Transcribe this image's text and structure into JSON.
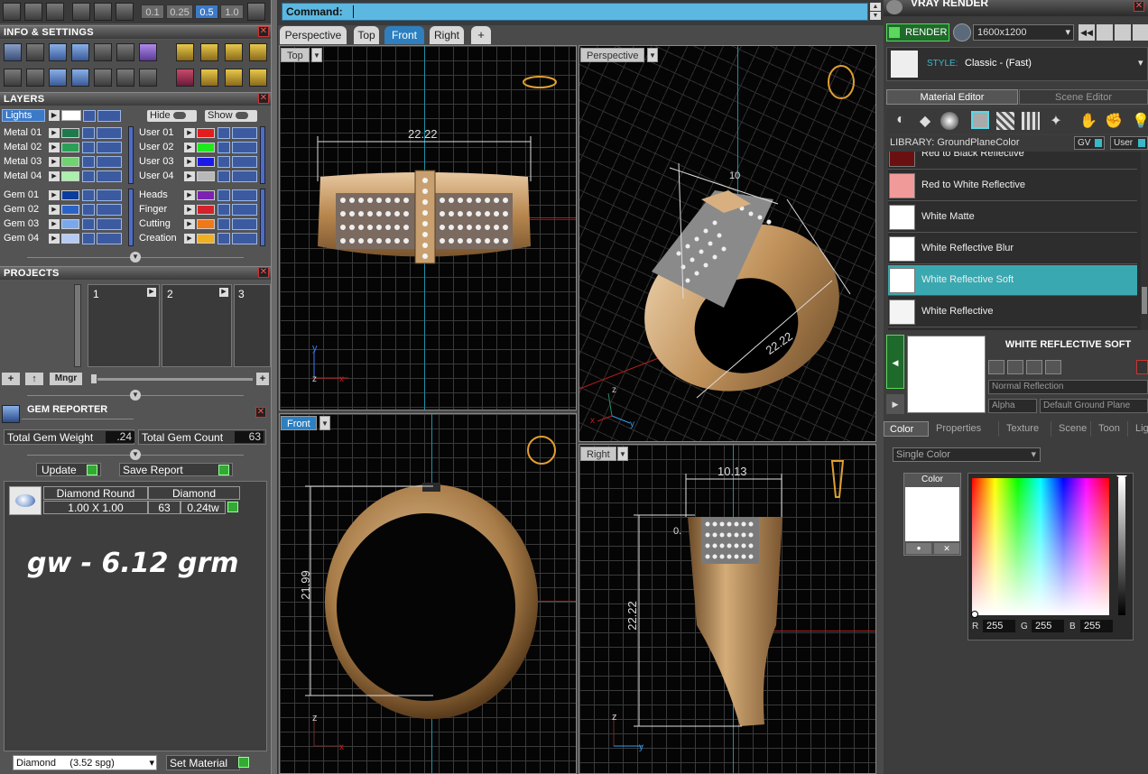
{
  "toolbar": {
    "zoom_values": [
      "0.1",
      "0.25",
      "0.5",
      "1.0"
    ],
    "zoom_selected": "0.5"
  },
  "info_settings": {
    "title": "INFO & SETTINGS"
  },
  "layers": {
    "title": "LAYERS",
    "lights_label": "Lights",
    "hide_label": "Hide",
    "show_label": "Show",
    "left_col": [
      {
        "name": "Metal 01",
        "color": "#1e7a4c"
      },
      {
        "name": "Metal 02",
        "color": "#2aa056"
      },
      {
        "name": "Metal 03",
        "color": "#6fd36f"
      },
      {
        "name": "Metal 04",
        "color": "#a9f0a9"
      },
      {
        "name": "Gem 01",
        "color": "#0a3d9c"
      },
      {
        "name": "Gem 02",
        "color": "#2a63c8"
      },
      {
        "name": "Gem 03",
        "color": "#7aa8ec"
      },
      {
        "name": "Gem 04",
        "color": "#b4ccf4"
      }
    ],
    "right_col": [
      {
        "name": "User 01",
        "color": "#e31d1d"
      },
      {
        "name": "User 02",
        "color": "#1ee81e"
      },
      {
        "name": "User 03",
        "color": "#1a1ae8"
      },
      {
        "name": "User 04",
        "color": "#b8b8b8"
      },
      {
        "name": "Heads",
        "color": "#7b22b0"
      },
      {
        "name": "Finger",
        "color": "#d4222a"
      },
      {
        "name": "Cutting",
        "color": "#f07818"
      },
      {
        "name": "Creation",
        "color": "#f0b020"
      }
    ]
  },
  "projects": {
    "title": "PROJECTS",
    "slots": [
      "1",
      "2",
      "3"
    ],
    "mngr_label": "Mngr"
  },
  "gem_reporter": {
    "title": "GEM REPORTER",
    "weight_label": "Total Gem Weight",
    "weight_value": ".24",
    "count_label": "Total Gem Count",
    "count_value": "63",
    "update_label": "Update",
    "save_report_label": "Save Report",
    "gem_shape": "Diamond Round",
    "gem_size": "1.00 X 1.00",
    "gem_type": "Diamond",
    "gem_count": "63",
    "gem_tw": "0.24tw",
    "annotation": "gw - 6.12 grm",
    "material_select": "Diamond     (3.52 spg)",
    "set_material_label": "Set Material"
  },
  "command": {
    "label": "Command:",
    "value": ""
  },
  "view_tabs": [
    "Perspective",
    "Top",
    "Front",
    "Right",
    "+"
  ],
  "active_view_tab": "Front",
  "viewports": {
    "top": {
      "label": "Top",
      "dimension": "22.22"
    },
    "perspective": {
      "label": "Perspective",
      "dimension": "22.22",
      "dimension2": "10"
    },
    "front": {
      "label": "Front",
      "dimension": "21.99"
    },
    "right": {
      "label": "Right",
      "dimension_top": "10.13",
      "dimension_side": "22.22",
      "dimension_small": "0."
    }
  },
  "vray": {
    "title": "VRAY RENDER",
    "render_label": "RENDER",
    "resolution": "1600x1200",
    "style_label": "STYLE:",
    "style_value": "Classic - (Fast)"
  },
  "material_editor": {
    "tab1": "Material Editor",
    "tab2": "Scene Editor",
    "library_label": "LIBRARY: GroundPlaneColor",
    "gv_label": "GV",
    "user_label": "User",
    "materials": [
      {
        "name": "Red to Black Reflective",
        "color": "#6b1010"
      },
      {
        "name": "Red to White Reflective",
        "color": "#f19a9a"
      },
      {
        "name": "White Matte",
        "color": "#ffffff"
      },
      {
        "name": "White Reflective Blur",
        "color": "#ffffff"
      },
      {
        "name": "White Reflective Soft",
        "color": "#ffffff"
      },
      {
        "name": "White Reflective",
        "color": "#f4f4f4"
      }
    ],
    "selected_material": "White Reflective Soft",
    "selected_title": "WHITE REFLECTIVE SOFT",
    "reflection_mode": "Normal Reflection",
    "alpha_label": "Alpha",
    "alpha_value": "Default Ground Plane",
    "prop_tabs": [
      "Color",
      "Properties",
      "Texture",
      "Scene",
      "Toon",
      "Light"
    ],
    "color_mode": "Single Color",
    "color_label": "Color",
    "r_label": "R",
    "r_value": "255",
    "g_label": "G",
    "g_value": "255",
    "b_label": "B",
    "b_value": "255"
  },
  "colors": {
    "accent": "#2d7fbf",
    "selected_row": "#3aa8b0",
    "gold": "#c9a06a"
  }
}
